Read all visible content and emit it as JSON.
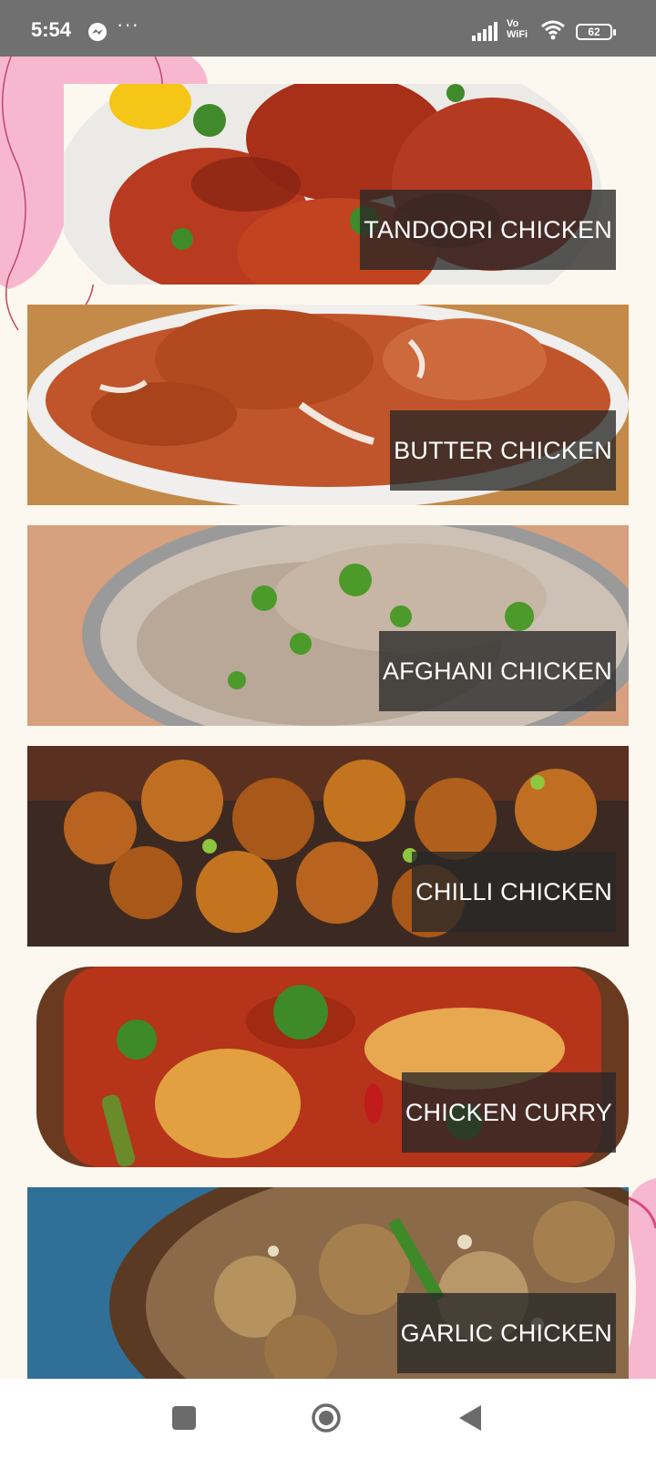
{
  "status_bar": {
    "time": "5:54",
    "more": "···",
    "network": "Vo WiFi",
    "battery": "62",
    "icons": [
      "messenger-icon",
      "signal-icon",
      "wifi-icon",
      "battery-icon"
    ]
  },
  "dishes": [
    {
      "label": "TANDOORI CHICKEN"
    },
    {
      "label": "BUTTER CHICKEN"
    },
    {
      "label": "AFGHANI CHICKEN"
    },
    {
      "label": "CHILLI CHICKEN"
    },
    {
      "label": "CHICKEN CURRY"
    },
    {
      "label": "GARLIC CHICKEN"
    }
  ],
  "nav_bar": {
    "icons": [
      "recents-square-icon",
      "home-circle-icon",
      "back-triangle-icon"
    ]
  },
  "colors": {
    "background": "#fdf8ef",
    "status_bar": "#707070",
    "accent_pink": "#f7b8cf",
    "label_bg": "#282828"
  }
}
